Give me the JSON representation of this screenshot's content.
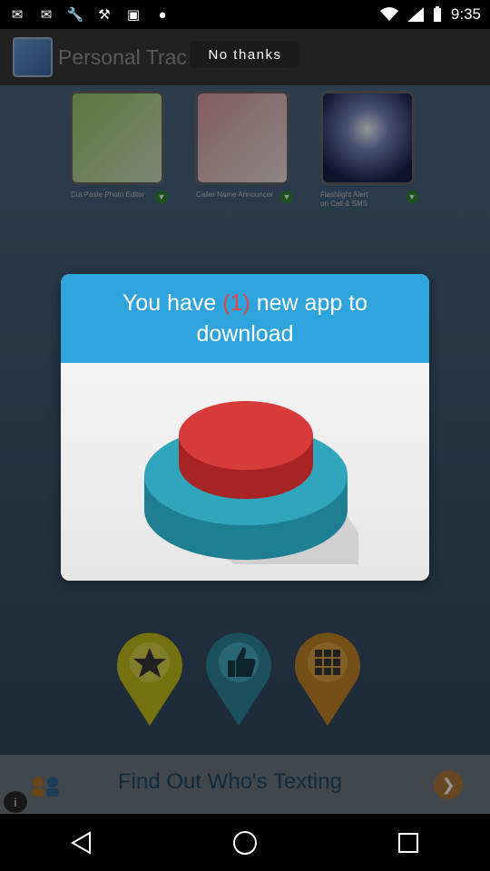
{
  "status_bar": {
    "time": "9:35",
    "left_icons": [
      "message-icon",
      "mail-icon",
      "wrench-icon",
      "tools-icon",
      "box-icon",
      "location-icon"
    ]
  },
  "app": {
    "title": "Personal Trac"
  },
  "no_thanks_label": "No thanks",
  "promos": [
    {
      "label": "Cut Paste Photo Editor"
    },
    {
      "label": "Caller Name Announcer"
    },
    {
      "label": "Flashlight Alert\non Call & SMS"
    }
  ],
  "dialog": {
    "title_before": "You have ",
    "title_count": "(1)",
    "title_after": " new app to download"
  },
  "ad": {
    "text": "Find Out Who's Texting"
  },
  "colors": {
    "dialog_header": "#2fa4dc",
    "count_red": "#e14848",
    "button_red": "#d93a3a",
    "button_base": "#2a9cb0"
  }
}
